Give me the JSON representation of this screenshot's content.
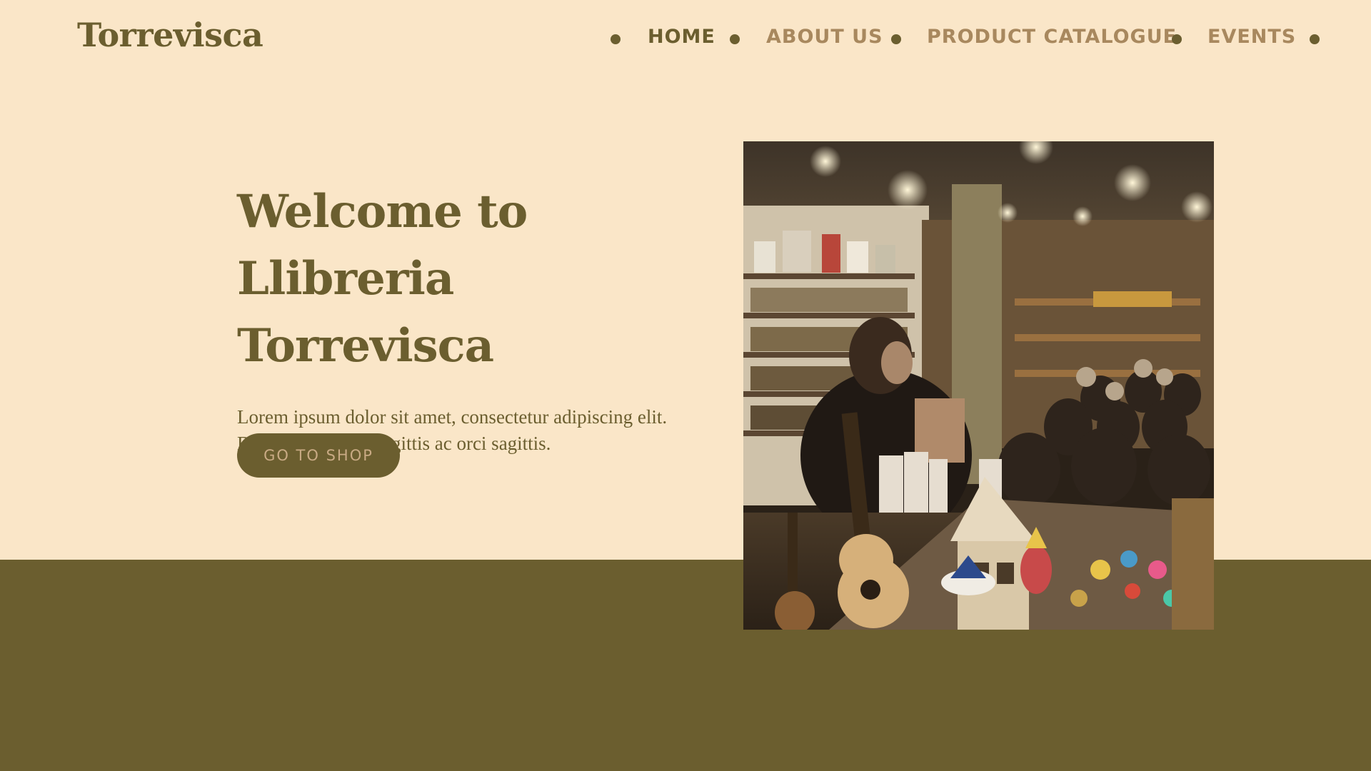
{
  "site": {
    "logo": "Torrevisca"
  },
  "nav": {
    "items": [
      {
        "label": "HOME",
        "active": true
      },
      {
        "label": "ABOUT US",
        "active": false
      },
      {
        "label": "PRODUCT CATALOGUE",
        "active": false
      },
      {
        "label": "EVENTS",
        "active": false
      }
    ]
  },
  "hero": {
    "heading_line1": "Welcome to",
    "heading_line2": "Llibreria Torrevisca",
    "body": "Lorem ipsum dolor sit amet, consectetur adipiscing elit. Duis augue risus, sagittis ac orci sagittis.",
    "button_label": "GO TO SHOP",
    "photo_icon": "bookstore-event-photo"
  },
  "colors": {
    "background": "#fae6c8",
    "olive": "#6b5e2f",
    "nav_inactive": "#a8885e",
    "button_text": "#c9aa84"
  }
}
